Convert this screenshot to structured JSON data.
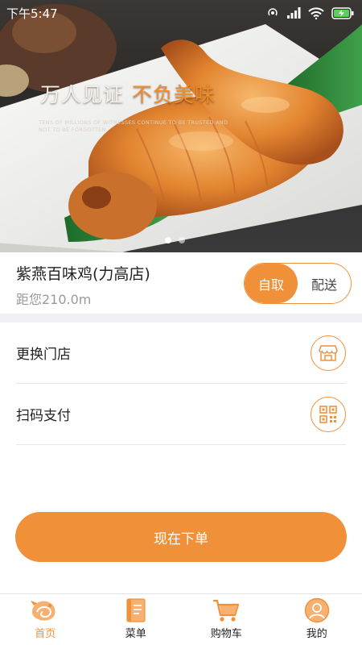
{
  "status_bar": {
    "time": "下午5:47"
  },
  "banner": {
    "slogan_main": "万人见证",
    "slogan_accent": "不负美味",
    "slogan_sub": "TENS OF MILLIONS OF WITNESSES CONTINUE TO BE TRUSTED AND NOT TO BE FORGOTTEN",
    "slide_count": 2,
    "active_slide": 1
  },
  "store": {
    "name": "紫燕百味鸡(力高店)",
    "distance": "距您210.0m",
    "mode_options": [
      "自取",
      "配送"
    ],
    "selected_mode": "自取"
  },
  "menu": {
    "change_store": "更换门店",
    "scan_pay": "扫码支付"
  },
  "order_button": "现在下单",
  "tabs": [
    {
      "label": "首页",
      "icon": "home-icon",
      "active": true
    },
    {
      "label": "菜单",
      "icon": "menu-book-icon",
      "active": false
    },
    {
      "label": "购物车",
      "icon": "cart-icon",
      "active": false
    },
    {
      "label": "我的",
      "icon": "profile-icon",
      "active": false
    }
  ],
  "colors": {
    "accent": "#f0913a",
    "band": "#efeff4",
    "muted_text": "#9a9a9a"
  }
}
